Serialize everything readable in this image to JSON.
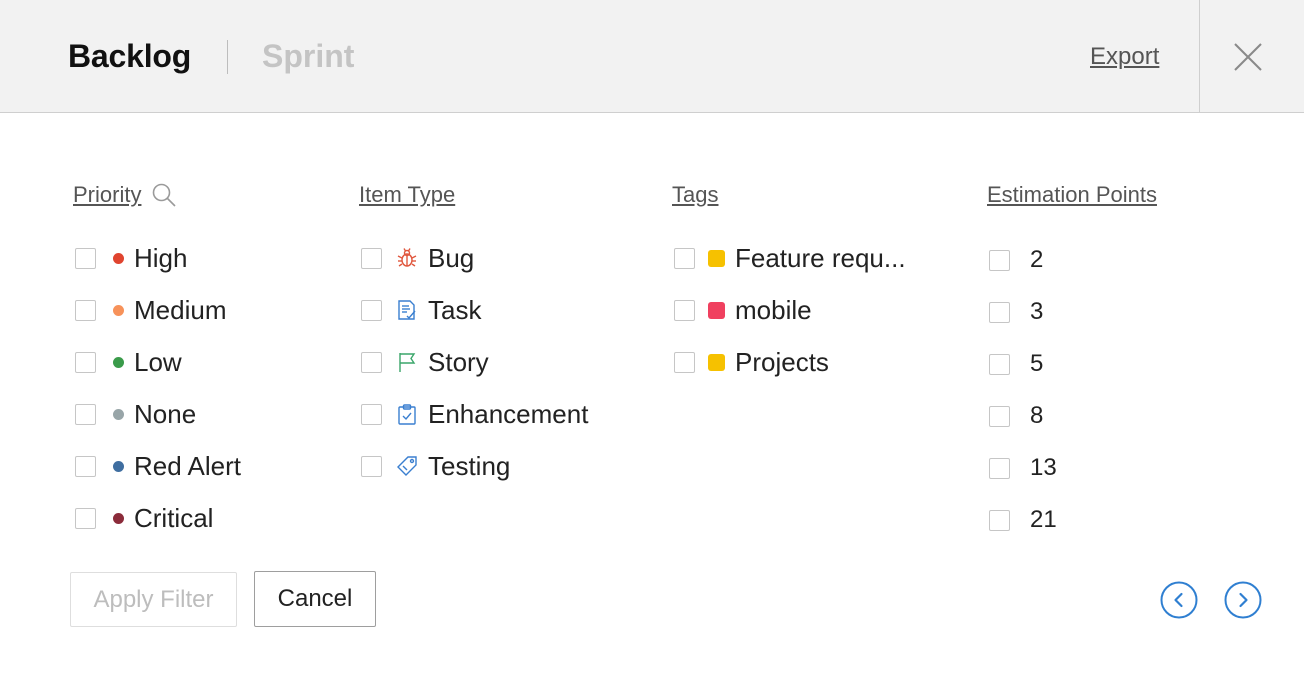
{
  "header": {
    "tabs": [
      {
        "label": "Backlog",
        "active": true
      },
      {
        "label": "Sprint",
        "active": false
      }
    ],
    "export_label": "Export"
  },
  "filters": {
    "priority": {
      "title": "Priority",
      "items": [
        {
          "label": "High",
          "color": "#e0442f"
        },
        {
          "label": "Medium",
          "color": "#f7925a"
        },
        {
          "label": "Low",
          "color": "#3a9b4a"
        },
        {
          "label": "None",
          "color": "#98a5a8"
        },
        {
          "label": "Red Alert",
          "color": "#3f6ea0"
        },
        {
          "label": "Critical",
          "color": "#8b2b3a"
        }
      ]
    },
    "item_type": {
      "title": "Item Type",
      "items": [
        {
          "label": "Bug",
          "icon": "bug-icon"
        },
        {
          "label": "Task",
          "icon": "task-icon"
        },
        {
          "label": "Story",
          "icon": "flag-icon"
        },
        {
          "label": "Enhancement",
          "icon": "clipboard-check-icon"
        },
        {
          "label": "Testing",
          "icon": "ticket-icon"
        }
      ]
    },
    "tags": {
      "title": "Tags",
      "items": [
        {
          "label": "Feature requ...",
          "color": "#f6c100"
        },
        {
          "label": "mobile",
          "color": "#f0405f"
        },
        {
          "label": "Projects",
          "color": "#f6c100"
        }
      ]
    },
    "estimation_points": {
      "title": "Estimation Points",
      "items": [
        {
          "label": "2"
        },
        {
          "label": "3"
        },
        {
          "label": "5"
        },
        {
          "label": "8"
        },
        {
          "label": "13"
        },
        {
          "label": "21"
        }
      ]
    }
  },
  "footer": {
    "apply_label": "Apply Filter",
    "cancel_label": "Cancel"
  },
  "colors": {
    "accent": "#2f7fd1",
    "header_bg": "#f2f2f2"
  }
}
